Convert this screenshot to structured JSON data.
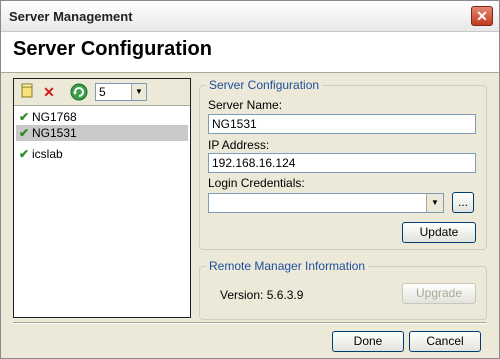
{
  "window": {
    "title": "Server Management",
    "close_glyph": "✕"
  },
  "header": {
    "title": "Server Configuration"
  },
  "toolbar": {
    "new_icon": "new-server-icon",
    "delete_icon": "delete-icon",
    "refresh_icon": "refresh-icon",
    "count_value": "5"
  },
  "servers": [
    {
      "name": "NG1768",
      "status": "ok",
      "selected": false
    },
    {
      "name": "NG1531",
      "status": "ok",
      "selected": true
    },
    {
      "name": "icslab",
      "status": "ok",
      "selected": false
    }
  ],
  "config": {
    "group_title": "Server Configuration",
    "server_name_label": "Server Name:",
    "server_name_value": "NG1531",
    "ip_label": "IP Address:",
    "ip_value": "192.168.16.124",
    "credentials_label": "Login Credentials:",
    "credentials_value": "",
    "browse_label": "...",
    "update_label": "Update"
  },
  "remote": {
    "group_title": "Remote Manager Information",
    "version_text": "Version: 5.6.3.9",
    "upgrade_label": "Upgrade"
  },
  "footer": {
    "done_label": "Done",
    "cancel_label": "Cancel"
  },
  "colors": {
    "accent": "#1f4e9c",
    "check": "#2e8b24",
    "close": "#c2391f"
  }
}
